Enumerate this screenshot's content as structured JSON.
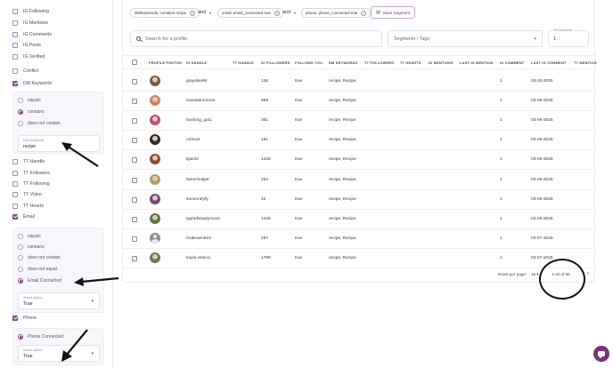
{
  "sidebar": {
    "top_items": [
      {
        "label": "IG Following",
        "checked": false
      },
      {
        "label": "IG Mentions",
        "checked": false
      },
      {
        "label": "IG Comments",
        "checked": false
      },
      {
        "label": "IG Posts",
        "checked": false
      },
      {
        "label": "IG Verified",
        "checked": false
      },
      {
        "label": "Conflict",
        "checked": false
      },
      {
        "label": "DM Keywords",
        "checked": true
      }
    ],
    "dm_panel": {
      "options": [
        "equals",
        "contains",
        "does not contain"
      ],
      "selected": "contains",
      "field_label": "DM Keywords*",
      "field_value": "recipe"
    },
    "mid_items": [
      {
        "label": "TT Handle",
        "checked": false
      },
      {
        "label": "TT Followers",
        "checked": false
      },
      {
        "label": "TT Following",
        "checked": false
      },
      {
        "label": "TT Video",
        "checked": false
      },
      {
        "label": "TT Hearts",
        "checked": false
      },
      {
        "label": "Email",
        "checked": true
      }
    ],
    "email_panel": {
      "options": [
        "equals",
        "contains",
        "does not contain",
        "does not equal",
        "Email Connected"
      ],
      "selected": "Email Connected",
      "field_label": "Select option",
      "field_value": "True"
    },
    "phone_item": {
      "label": "Phone",
      "checked": true
    },
    "phone_panel": {
      "options": [
        "Phone Connected"
      ],
      "selected": "Phone Connected",
      "field_label": "Select option",
      "field_value": "True"
    }
  },
  "filters": {
    "chip1": "DMKeywords: contains recipe",
    "and1": "and",
    "chip2": "email: email_connected true",
    "and2": "and",
    "chip3": "phone: phone_connected true",
    "save_label": "Save Segment"
  },
  "search": {
    "placeholder": "Search for a profile"
  },
  "segments": {
    "placeholder": "Segments / Tags"
  },
  "min_field": {
    "label": "DM Keywords",
    "value": "1"
  },
  "table": {
    "columns": [
      "PROFILE PHOTOS",
      "IG HANDLE",
      "TT HANDLE",
      "IG FOLLOWERS",
      "FOLLOWS YOU",
      "DM KEYWORDS",
      "TT FOLLOWERS",
      "TT HEARTS",
      "IG MENTIONS",
      "LAST IG MENTION",
      "IG COMMENT",
      "LAST IG COMMENT",
      "TT MENTION"
    ],
    "rows": [
      {
        "handle": "grayskie86",
        "followers": "136",
        "follows": "true",
        "keywords": "recipe, Recipe",
        "comment": "1",
        "last_comment": "03-10-2025",
        "avatar_color": "#7a5a4a"
      },
      {
        "handle": "maradamonroe",
        "followers": "999",
        "follows": "true",
        "keywords": "recipe, Recipe",
        "comment": "1",
        "last_comment": "03-09-2025",
        "avatar_color": "#c7846a"
      },
      {
        "handle": "tracking_gal1",
        "followers": "361",
        "follows": "true",
        "keywords": "recipe, Recipe",
        "comment": "1",
        "last_comment": "03-09-2025",
        "avatar_color": "#c04f7c"
      },
      {
        "handle": "notsoct",
        "followers": "181",
        "follows": "true",
        "keywords": "recipe, Recipe",
        "comment": "1",
        "last_comment": "03-09-2025",
        "avatar_color": "#2b2b2b"
      },
      {
        "handle": "kjas32",
        "followers": "1225",
        "follows": "true",
        "keywords": "recipe, Recipe",
        "comment": "1",
        "last_comment": "03-09-2025",
        "avatar_color": "#8e4a3a"
      },
      {
        "handle": "lainecholger",
        "followers": "262",
        "follows": "true",
        "keywords": "recipe, Recipe",
        "comment": "1",
        "last_comment": "03-09-2025",
        "avatar_color": "#a8a06a"
      },
      {
        "handle": "sunnnntryfy",
        "followers": "42",
        "follows": "true",
        "keywords": "recipe, Recipe",
        "comment": "1",
        "last_comment": "03-09-2025",
        "avatar_color": "#6a4a8a"
      },
      {
        "handle": "taylorbeautymoon",
        "followers": "1436",
        "follows": "true",
        "keywords": "recipe, Recipe",
        "comment": "1",
        "last_comment": "03-08-2025",
        "avatar_color": "#5a7a4a"
      },
      {
        "handle": "mobrown815",
        "followers": "297",
        "follows": "true",
        "keywords": "recipe, Recipe",
        "comment": "1",
        "last_comment": "03-07-2025",
        "avatar_color": "placeholder"
      },
      {
        "handle": "kayla.velucci",
        "followers": "1789",
        "follows": "true",
        "keywords": "recipe, Recipe",
        "comment": "1",
        "last_comment": "03-07-2025",
        "avatar_color": "#6a7a5a"
      }
    ]
  },
  "pagination": {
    "rows_label": "Rows per page:",
    "rows_value": "15",
    "range": "1-10 of 66"
  }
}
